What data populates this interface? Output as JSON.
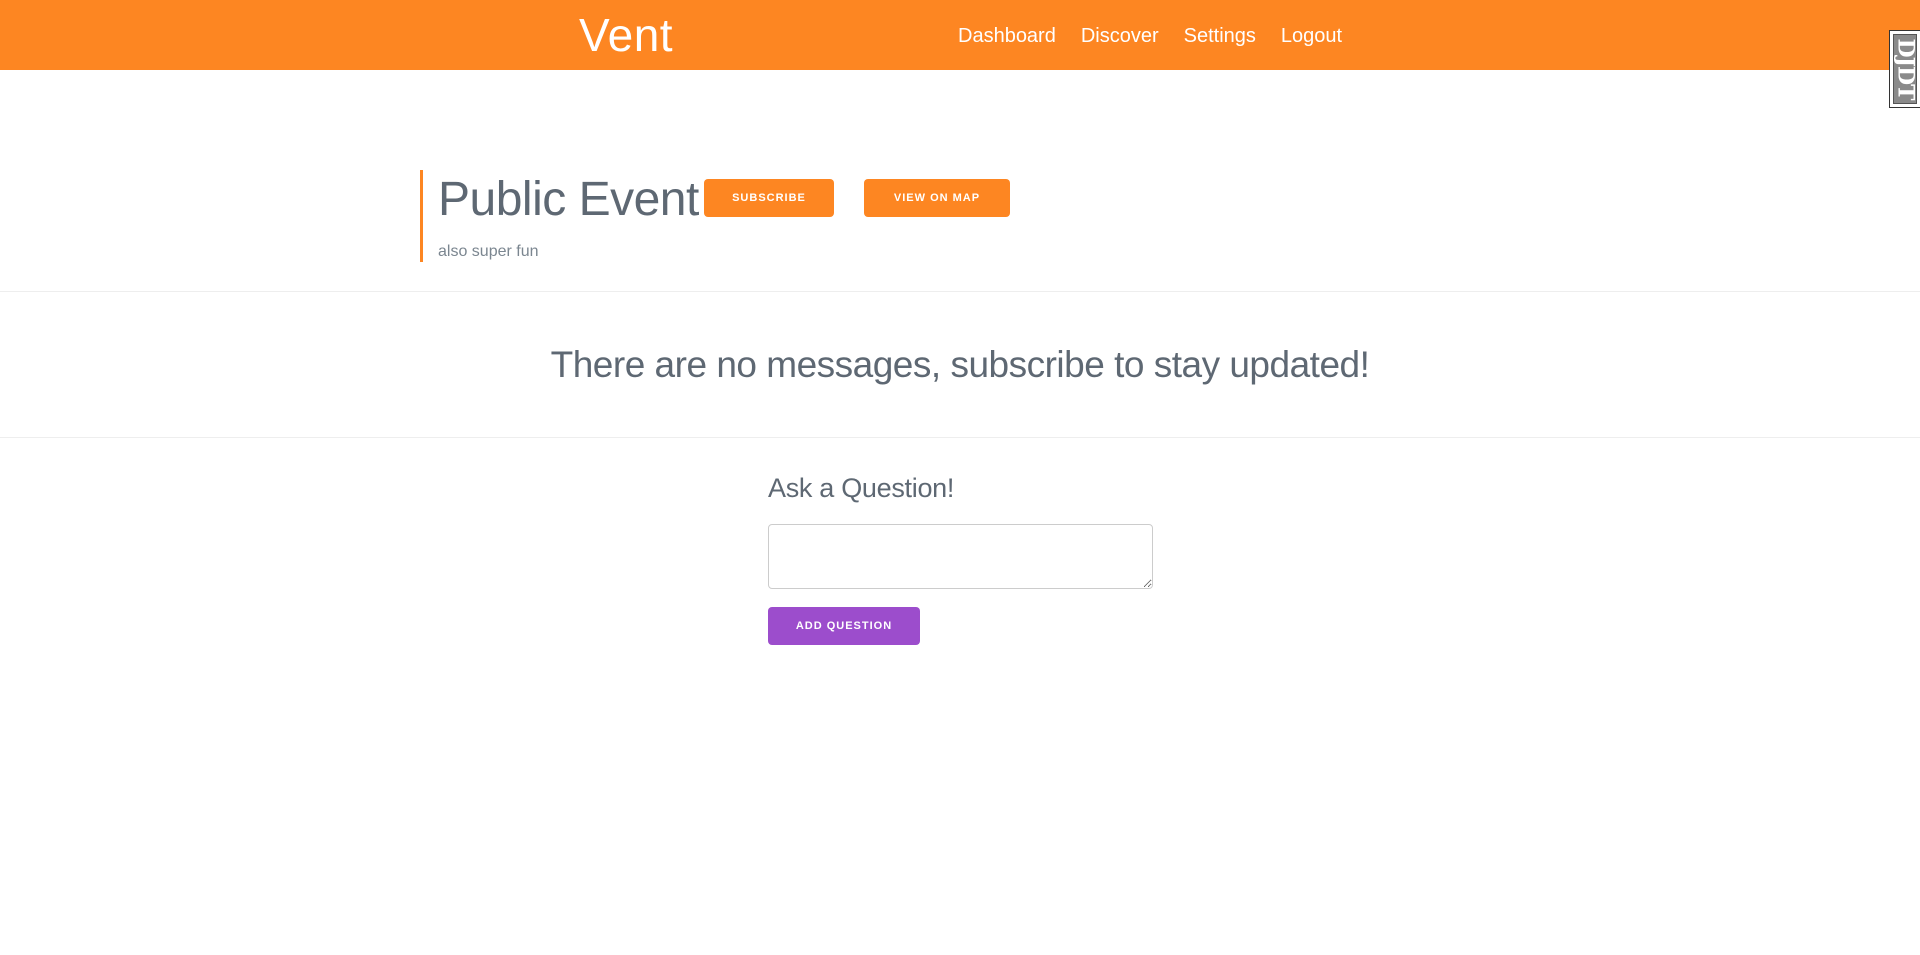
{
  "navbar": {
    "brand": "Vent",
    "links": [
      "Dashboard",
      "Discover",
      "Settings",
      "Logout"
    ],
    "background_color": "#fd8622"
  },
  "debug_toolbar": {
    "label": "DJDT"
  },
  "event": {
    "title": "Public Event",
    "subtitle": "also super fun",
    "subscribe_label": "Subscribe",
    "map_label": "View on map",
    "accent_color": "#fd8622"
  },
  "messages": {
    "empty_text": "There are no messages, subscribe to stay updated!"
  },
  "question_form": {
    "heading": "Ask a Question!",
    "input_value": "",
    "submit_label": "Add Question",
    "submit_color": "#9c4dcc"
  }
}
